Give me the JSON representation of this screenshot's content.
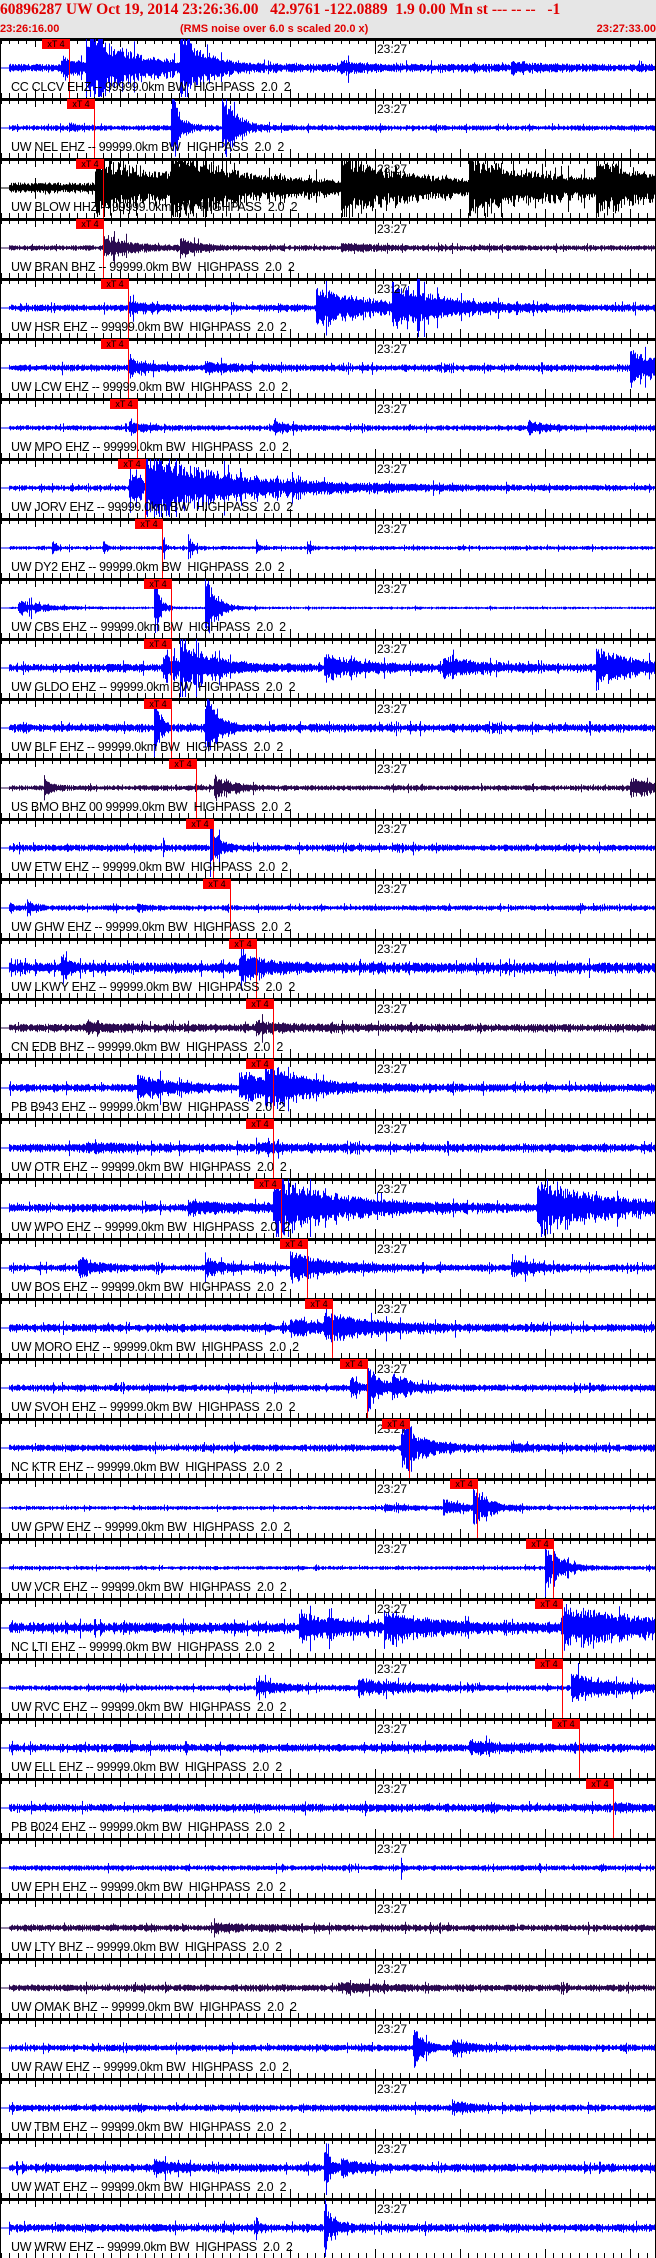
{
  "header": {
    "title": "60896287 UW Oct 19, 2014 23:26:36.00   42.9761 -122.0889  1.9 0.00 Mn st --- -- --   -1",
    "start_time": "23:26:16.00",
    "note": "(RMS noise over 6.0 s scaled 20.0 x)",
    "end_time": "23:27:33.00"
  },
  "axis": {
    "minute_label": "23:27",
    "window_seconds": 77,
    "minute_offset_s": 44
  },
  "pick_label": "xT 4",
  "colors": {
    "header_text": "#e00000",
    "pick": "#ff0000",
    "trace_blue": "#0000ff",
    "trace_black": "#000000",
    "trace_purple": "#2a0a50"
  },
  "traces": [
    {
      "label": "CC CLCV EHZ -- 99999.0km BW  HIGHPASS  2.0  2",
      "pick_s": 8.0
    },
    {
      "label": "UW NEL EHZ -- 99999.0km BW  HIGHPASS  2.0  2",
      "pick_s": 11.0
    },
    {
      "label": "UW BLOW HHZ -- 99999.0km BW  HIGHPASS  2.0  2",
      "pick_s": 12.0
    },
    {
      "label": "UW BRAN BHZ -- 99999.0km BW  HIGHPASS  2.0  2",
      "pick_s": 12.0
    },
    {
      "label": "UW HSR EHZ -- 99999.0km BW  HIGHPASS  2.0  2",
      "pick_s": 15.0
    },
    {
      "label": "UW LCW EHZ -- 99999.0km BW  HIGHPASS  2.0  2",
      "pick_s": 15.0
    },
    {
      "label": "UW MPO EHZ -- 99999.0km BW  HIGHPASS  2.0  2",
      "pick_s": 16.0
    },
    {
      "label": "UW JORV EHZ -- 99999.0km BW  HIGHPASS  2.0  2",
      "pick_s": 17.0
    },
    {
      "label": "UW DY2 EHZ -- 99999.0km BW  HIGHPASS  2.0  2",
      "pick_s": 19.0
    },
    {
      "label": "UW CBS EHZ -- 99999.0km BW  HIGHPASS  2.0  2",
      "pick_s": 20.0
    },
    {
      "label": "UW GLDO EHZ -- 99999.0km BW  HIGHPASS  2.0  2",
      "pick_s": 20.0
    },
    {
      "label": "UW BLF EHZ -- 99999.0km BW  HIGHPASS  2.0  2",
      "pick_s": 20.0
    },
    {
      "label": "US BMO BHZ 00 99999.0km BW  HIGHPASS  2.0  2",
      "pick_s": 23.0
    },
    {
      "label": "UW ETW EHZ -- 99999.0km BW  HIGHPASS  2.0  2",
      "pick_s": 25.0
    },
    {
      "label": "UW GHW EHZ -- 99999.0km BW  HIGHPASS  2.0  2",
      "pick_s": 27.0
    },
    {
      "label": "UW LKWY EHZ -- 99999.0km BW  HIGHPASS  2.0  2",
      "pick_s": 30.0
    },
    {
      "label": "CN EDB BHZ -- 99999.0km BW  HIGHPASS  2.0  2",
      "pick_s": 32.0
    },
    {
      "label": "PB B943 EHZ -- 99999.0km BW  HIGHPASS  2.0  2",
      "pick_s": 32.0
    },
    {
      "label": "UW OTR EHZ -- 99999.0km BW  HIGHPASS  2.0  2",
      "pick_s": 32.0
    },
    {
      "label": "UW WPO EHZ -- 99999.0km BW  HIGHPASS  2.0  2",
      "pick_s": 33.0
    },
    {
      "label": "UW BOS EHZ -- 99999.0km BW  HIGHPASS  2.0  2",
      "pick_s": 36.0
    },
    {
      "label": "UW MORO EHZ -- 99999.0km BW  HIGHPASS  2.0  2",
      "pick_s": 39.0
    },
    {
      "label": "UW SVOH EHZ -- 99999.0km BW  HIGHPASS  2.0  2",
      "pick_s": 43.1
    },
    {
      "label": "NC KTR EHZ -- 99999.0km BW  HIGHPASS  2.0  2",
      "pick_s": 48.0
    },
    {
      "label": "UW GPW EHZ -- 99999.0km BW  HIGHPASS  2.0  2",
      "pick_s": 56.0
    },
    {
      "label": "UW VCR EHZ -- 99999.0km BW  HIGHPASS  2.0  2",
      "pick_s": 65.0
    },
    {
      "label": "NC LTI EHZ -- 99999.0km BW  HIGHPASS  2.0  2",
      "pick_s": 66.0
    },
    {
      "label": "UW RVC EHZ -- 99999.0km BW  HIGHPASS  2.0  2",
      "pick_s": 66.0
    },
    {
      "label": "UW ELL EHZ -- 99999.0km BW  HIGHPASS  2.0  2",
      "pick_s": 68.0
    },
    {
      "label": "PB B024 EHZ -- 99999.0km BW  HIGHPASS  2.0  2",
      "pick_s": 72.0
    },
    {
      "label": "UW EPH EHZ -- 99999.0km BW  HIGHPASS  2.0  2",
      "pick_s": null
    },
    {
      "label": "UW LTY BHZ -- 99999.0km BW  HIGHPASS  2.0  2",
      "pick_s": null
    },
    {
      "label": "UW OMAK BHZ -- 99999.0km BW  HIGHPASS  2.0  2",
      "pick_s": null
    },
    {
      "label": "UW RAW EHZ -- 99999.0km BW  HIGHPASS  2.0  2",
      "pick_s": null
    },
    {
      "label": "UW TBM EHZ -- 99999.0km BW  HIGHPASS  2.0  2",
      "pick_s": null
    },
    {
      "label": "UW WAT EHZ -- 99999.0km BW  HIGHPASS  2.0  2",
      "pick_s": null
    },
    {
      "label": "UW WRW EHZ -- 99999.0km BW  HIGHPASS  2.0  2",
      "pick_s": null
    }
  ]
}
